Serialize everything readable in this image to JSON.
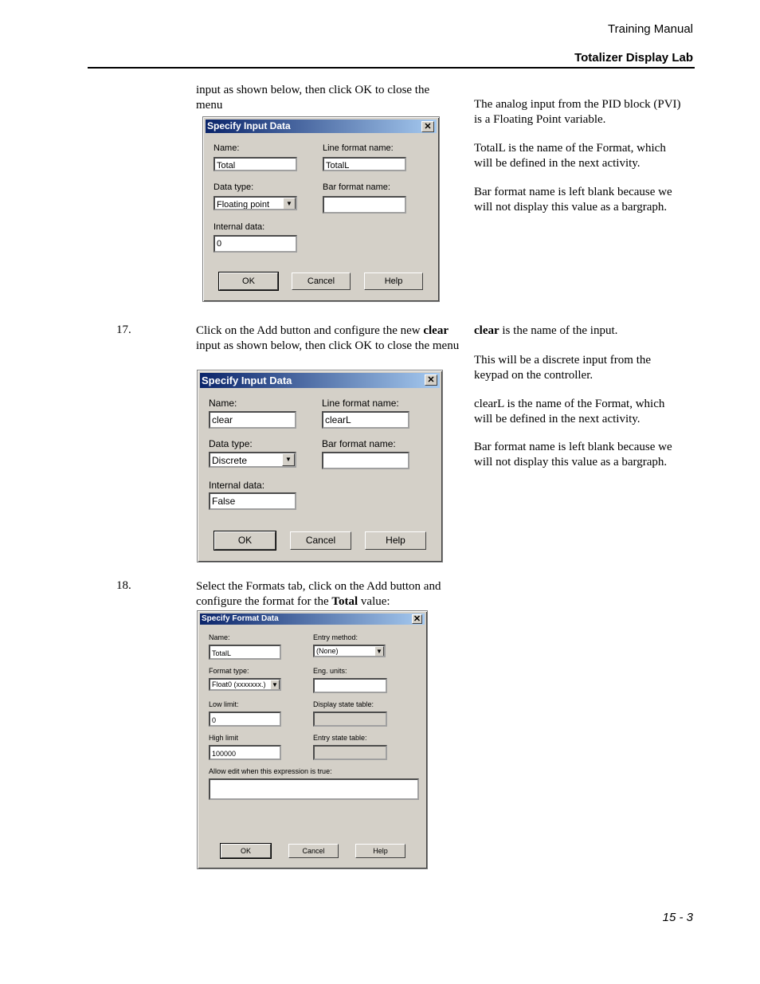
{
  "header": {
    "manual": "Training Manual",
    "section": "Totalizer Display Lab"
  },
  "intro": {
    "text": "input as shown below, then click OK to close the menu"
  },
  "notes1": [
    "The analog input from the PID block (PVI) is a Floating Point variable.",
    "TotalL is the name of the Format, which will be defined in the next activity.",
    "Bar format name is left blank because we will not display this value as a bargraph."
  ],
  "dialog1": {
    "title": "Specify Input Data",
    "name_label": "Name:",
    "name": "Total",
    "line_label": "Line format name:",
    "line": "TotalL",
    "type_label": "Data type:",
    "type": "Floating point",
    "bar_label": "Bar format name:",
    "bar": "",
    "internal_label": "Internal data:",
    "internal": "0",
    "ok": "OK",
    "cancel": "Cancel",
    "help": "Help"
  },
  "step17": {
    "num": "17.",
    "pre": "Click on the Add button and configure the new ",
    "bold": "clear",
    "post": " input as shown below, then click OK to close the menu"
  },
  "notes2": {
    "bold": "clear",
    "first": " is the name of the input.",
    "items": [
      "This will be a discrete input from the keypad on the controller.",
      "clearL is the name of the Format, which will be defined in the next activity.",
      "Bar format name is left blank because we will not display this value as a bargraph."
    ]
  },
  "dialog2": {
    "title": "Specify Input Data",
    "name_label": "Name:",
    "name": "clear",
    "line_label": "Line format name:",
    "line": "clearL",
    "type_label": "Data type:",
    "type": "Discrete",
    "bar_label": "Bar format name:",
    "bar": "",
    "internal_label": "Internal data:",
    "internal": "False",
    "ok": "OK",
    "cancel": "Cancel",
    "help": "Help"
  },
  "step18": {
    "num": "18.",
    "pre": "Select the Formats tab, click on the Add button and configure the format for the ",
    "bold": "Total",
    "post": " value:"
  },
  "dialog3": {
    "title": "Specify Format Data",
    "name_label": "Name:",
    "name": "TotalL",
    "entry_label": "Entry method:",
    "entry": "(None)",
    "ftype_label": "Format type:",
    "ftype": "Float0 (xxxxxxx.)",
    "units_label": "Eng. units:",
    "units": "",
    "low_label": "Low limit:",
    "low": "0",
    "dst_label": "Display state table:",
    "high_label": "High limit",
    "high": "100000",
    "est_label": "Entry state table:",
    "allow_label": "Allow edit when this expression is true:",
    "allow": "",
    "ok": "OK",
    "cancel": "Cancel",
    "help": "Help"
  },
  "footer": {
    "page": "15 - 3"
  }
}
